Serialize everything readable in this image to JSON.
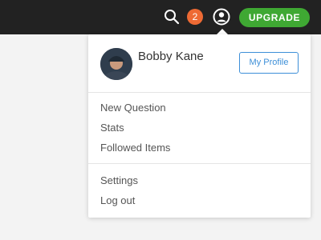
{
  "topbar": {
    "notification_count": "2",
    "upgrade_label": "UPGRADE"
  },
  "dropdown": {
    "user_name": "Bobby Kane",
    "profile_button": "My Profile",
    "menu_primary": [
      "New Question",
      "Stats",
      "Followed Items"
    ],
    "menu_secondary": [
      "Settings",
      "Log out"
    ]
  },
  "colors": {
    "topbar_bg": "#222222",
    "badge": "#ee6a34",
    "upgrade": "#3fa833",
    "profile_accent": "#3d8fd8"
  },
  "icons": {
    "search": "search-icon",
    "user": "user-circle-icon"
  }
}
